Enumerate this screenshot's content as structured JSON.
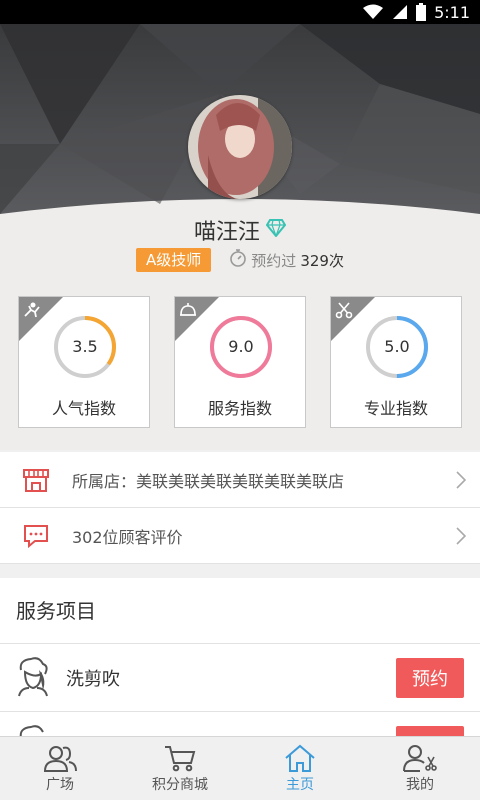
{
  "status_bar": {
    "time": "5:11"
  },
  "profile": {
    "name": "喵汪汪",
    "level_badge": "A级技师",
    "booked_label": "预约过",
    "booked_count": "329次"
  },
  "scores": [
    {
      "value": "3.5",
      "label": "人气指数",
      "fraction": 0.35,
      "color": "#f5a531",
      "icon": "popularity-icon"
    },
    {
      "value": "9.0",
      "label": "服务指数",
      "fraction": 1.0,
      "color": "#f07a9a",
      "icon": "service-bell-icon"
    },
    {
      "value": "5.0",
      "label": "专业指数",
      "fraction": 0.5,
      "color": "#5aa9ee",
      "icon": "scissors-icon"
    }
  ],
  "list": {
    "store": "所属店：美联美联美联美联美联美联店",
    "reviews": "302位顾客评价"
  },
  "services": {
    "title": "服务项目",
    "items": [
      {
        "name": "洗剪吹",
        "button": "预约"
      },
      {
        "name": "",
        "button": "预约"
      }
    ]
  },
  "nav": [
    {
      "label": "广场",
      "icon": "people-icon"
    },
    {
      "label": "积分商城",
      "icon": "cart-icon"
    },
    {
      "label": "主页",
      "icon": "home-icon"
    },
    {
      "label": "我的",
      "icon": "user-scissors-icon"
    }
  ],
  "colors": {
    "accent": "#3c9ad9",
    "badge": "#f59a35",
    "button": "#f05a5a"
  }
}
